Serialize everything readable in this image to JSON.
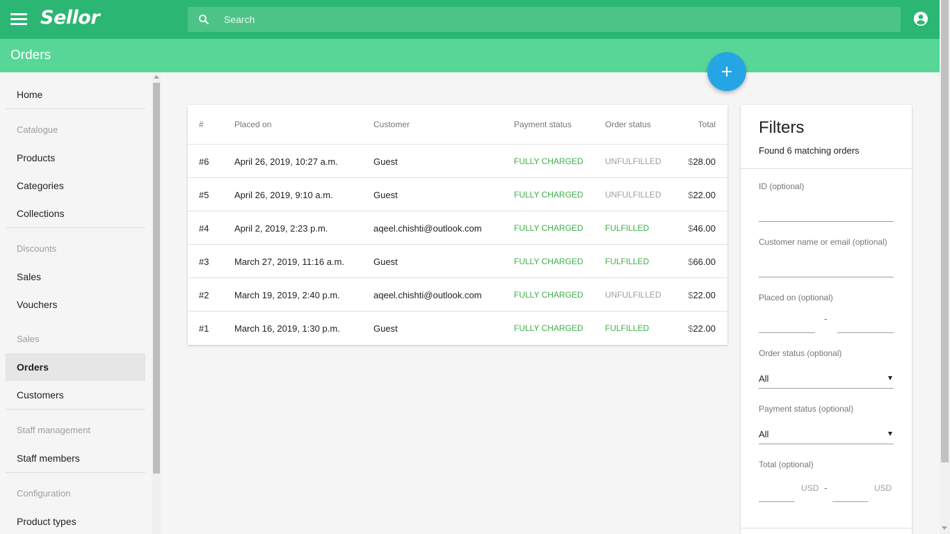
{
  "app": {
    "logo": "Sellor",
    "search_placeholder": "Search",
    "page_title": "Orders"
  },
  "icons": {
    "menu": "hamburger-icon",
    "search": "search-icon",
    "account": "account-circle-icon",
    "add": "plus-icon"
  },
  "colors": {
    "appbar": "#2bb673",
    "subbar": "#57d697",
    "fab": "#26a5e4",
    "charged": "#3fae49",
    "unfulfilled": "#9e9e9e"
  },
  "sidebar": {
    "home": "Home",
    "catalogue_header": "Catalogue",
    "products": "Products",
    "categories": "Categories",
    "collections": "Collections",
    "discounts_header": "Discounts",
    "sales": "Sales",
    "vouchers": "Vouchers",
    "sales_header": "Sales",
    "orders": "Orders",
    "customers": "Customers",
    "staff_header": "Staff management",
    "staff_members": "Staff members",
    "config_header": "Configuration",
    "product_types": "Product types",
    "active": "Orders"
  },
  "table": {
    "headers": {
      "number": "#",
      "placed_on": "Placed on",
      "customer": "Customer",
      "payment_status": "Payment status",
      "order_status": "Order status",
      "total": "Total"
    },
    "rows": [
      {
        "number": "#6",
        "placed_on": "April 26, 2019, 10:27 a.m.",
        "customer": "Guest",
        "payment": "FULLY CHARGED",
        "status": "UNFULFILLED",
        "currency": "$",
        "amount": "28.00"
      },
      {
        "number": "#5",
        "placed_on": "April 26, 2019, 9:10 a.m.",
        "customer": "Guest",
        "payment": "FULLY CHARGED",
        "status": "UNFULFILLED",
        "currency": "$",
        "amount": "22.00"
      },
      {
        "number": "#4",
        "placed_on": "April 2, 2019, 2:23 p.m.",
        "customer": "aqeel.chishti@outlook.com",
        "payment": "FULLY CHARGED",
        "status": "FULFILLED",
        "currency": "$",
        "amount": "46.00"
      },
      {
        "number": "#3",
        "placed_on": "March 27, 2019, 11:16 a.m.",
        "customer": "Guest",
        "payment": "FULLY CHARGED",
        "status": "FULFILLED",
        "currency": "$",
        "amount": "66.00"
      },
      {
        "number": "#2",
        "placed_on": "March 19, 2019, 2:40 p.m.",
        "customer": "aqeel.chishti@outlook.com",
        "payment": "FULLY CHARGED",
        "status": "UNFULFILLED",
        "currency": "$",
        "amount": "22.00"
      },
      {
        "number": "#1",
        "placed_on": "March 16, 2019, 1:30 p.m.",
        "customer": "Guest",
        "payment": "FULLY CHARGED",
        "status": "FULFILLED",
        "currency": "$",
        "amount": "22.00"
      }
    ]
  },
  "filters": {
    "title": "Filters",
    "found": "Found 6 matching orders",
    "id_label": "ID (optional)",
    "customer_label": "Customer name or email (optional)",
    "placed_label": "Placed on (optional)",
    "range_dash": "-",
    "order_status_label": "Order status (optional)",
    "order_status_value": "All",
    "payment_status_label": "Payment status (optional)",
    "payment_status_value": "All",
    "total_label": "Total (optional)",
    "currency_unit": "USD"
  }
}
